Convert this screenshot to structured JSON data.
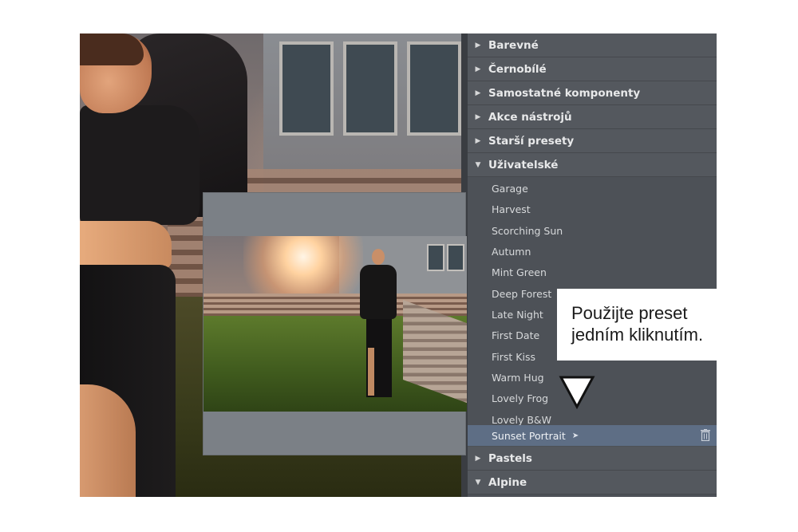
{
  "panel": {
    "categories_top": [
      {
        "label": "Barevné",
        "expanded": false
      },
      {
        "label": "Černobílé",
        "expanded": false
      },
      {
        "label": "Samostatné komponenty",
        "expanded": false
      },
      {
        "label": "Akce nástrojů",
        "expanded": false
      },
      {
        "label": "Starší presety",
        "expanded": false
      },
      {
        "label": "Uživatelské",
        "expanded": true
      }
    ],
    "presets": [
      "Garage",
      "Harvest",
      "Scorching Sun",
      "Autumn",
      "Mint Green",
      "Deep Forest",
      "Late Night",
      "First Date",
      "First Kiss",
      "Warm Hug",
      "Lovely Frog",
      "Lovely B&W",
      "Sunset Portrait"
    ],
    "selected_preset": "Sunset Portrait",
    "categories_bottom": [
      {
        "label": "Pastels",
        "expanded": false
      },
      {
        "label": "Alpine",
        "expanded": true
      }
    ],
    "colors": {
      "panel": "#4d5157",
      "category": "#54585e",
      "selected": "#5e6e85"
    }
  },
  "callout": {
    "line1": "Použijte preset",
    "line2": "jedním kliknutím."
  },
  "icons": {
    "collapsed": "triangle-right-icon",
    "expanded": "triangle-down-icon",
    "cursor": "cursor-icon",
    "delete": "trash-icon",
    "pointer": "down-triangle-icon"
  }
}
